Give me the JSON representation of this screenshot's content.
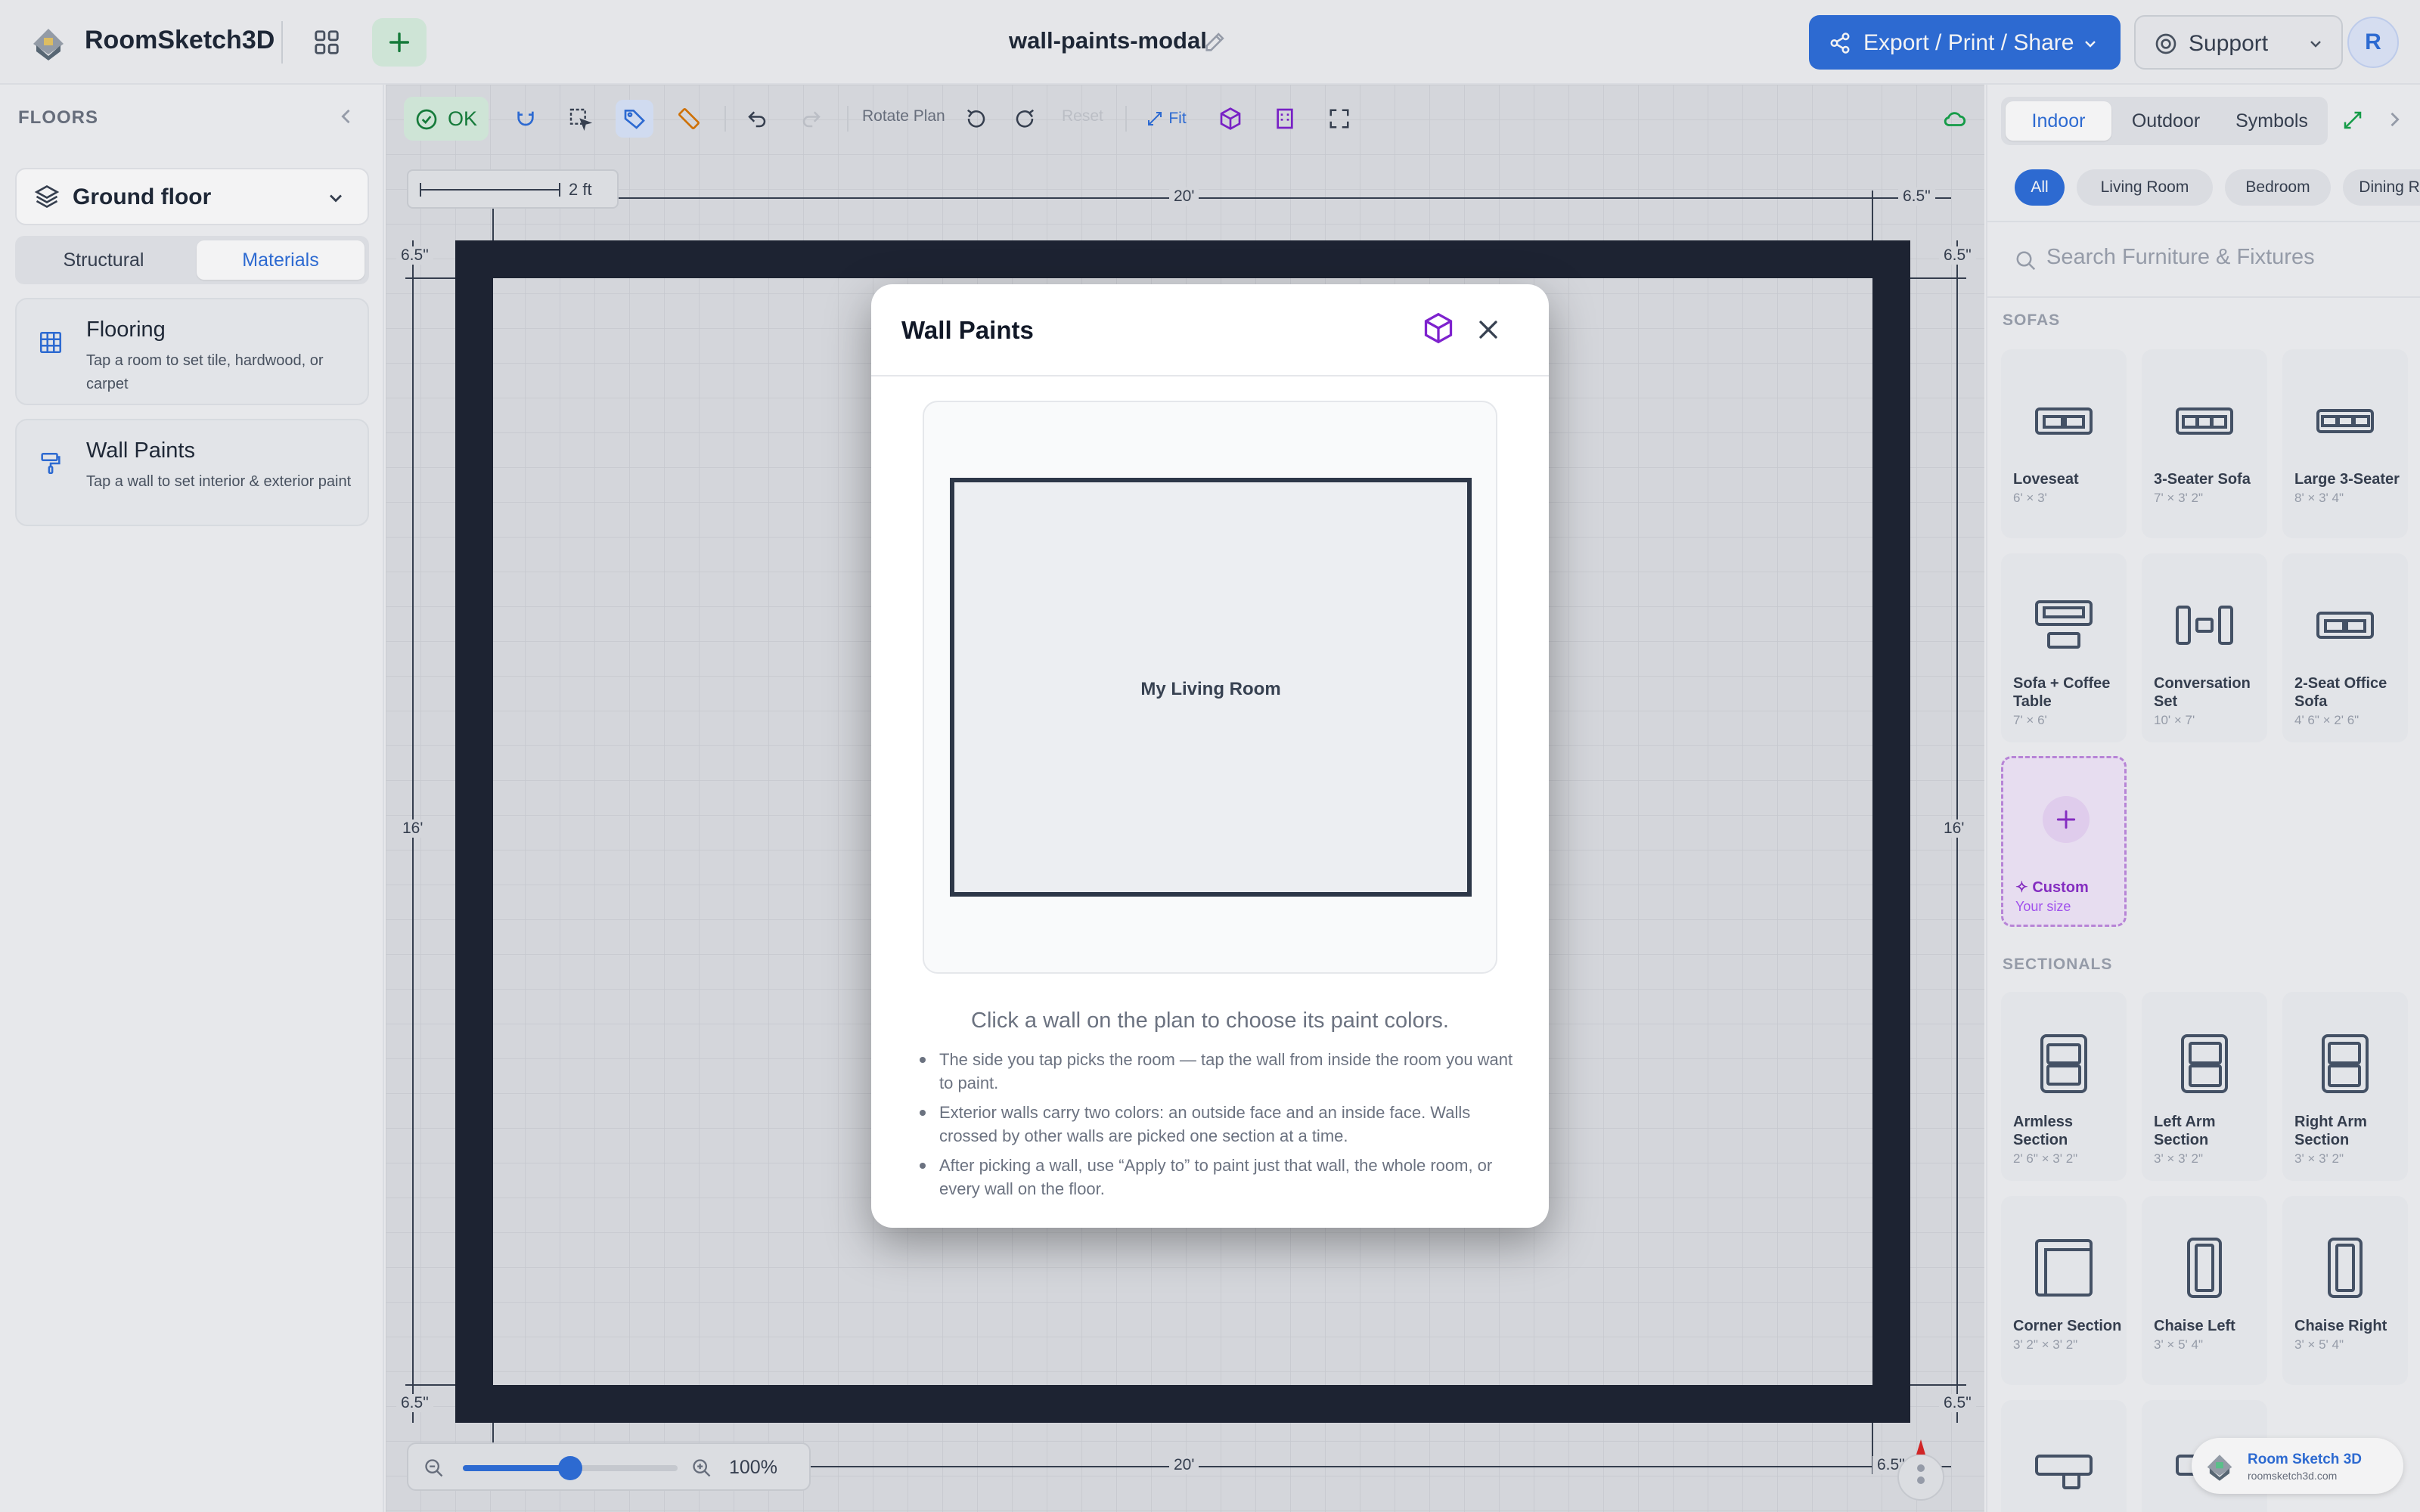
{
  "header": {
    "app_name": "RoomSketch3D",
    "doc_title": "wall-paints-modal",
    "export_label": "Export / Print / Share",
    "support_label": "Support",
    "avatar_initial": "R",
    "accent": "#2f6fdb"
  },
  "left": {
    "floors_label": "FLOORS",
    "floor_selected": "Ground floor",
    "tabs": [
      "Structural",
      "Materials"
    ],
    "active_tab": "Materials",
    "cards": [
      {
        "title": "Flooring",
        "desc": "Tap a room to set tile, hardwood, or carpet",
        "icon": "grid-icon"
      },
      {
        "title": "Wall Paints",
        "desc": "Tap a wall to set interior & exterior paint",
        "icon": "paint-roller-icon"
      }
    ]
  },
  "toolbar": {
    "ok_label": "OK",
    "rotate_label": "Rotate Plan",
    "reset_label": "Reset",
    "fit_label": "Fit",
    "active_tool": "tag-icon"
  },
  "canvas": {
    "scale_label": "2 ft",
    "dim_top": "20'",
    "dim_bottom": "20'",
    "dim_left": "16'",
    "dim_right": "16'",
    "wall_thickness_label": "6.5\"",
    "zoom_label": "100%",
    "zoom_fraction": 0.5,
    "wall_color": "#1e2433"
  },
  "modal": {
    "title": "Wall Paints",
    "room_label": "My Living Room",
    "hint": "Click a wall on the plan to choose its paint colors.",
    "tips": [
      "The side you tap picks the room — tap the wall from inside the room you want to paint.",
      "Exterior walls carry two colors: an outside face and an inside face. Walls crossed by other walls are picked one section at a time.",
      "After picking a wall, use “Apply to” to paint just that wall, the whole room, or every wall on the floor."
    ]
  },
  "right": {
    "tabs": [
      "Indoor",
      "Outdoor",
      "Symbols"
    ],
    "active_tab": "Indoor",
    "chips": [
      "All",
      "Living Room",
      "Bedroom",
      "Dining Room"
    ],
    "active_chip": "All",
    "search_placeholder": "Search Furniture & Fixtures",
    "sections": [
      {
        "label": "SOFAS",
        "items": [
          {
            "name": "Loveseat",
            "size": "6' × 3'"
          },
          {
            "name": "3-Seater Sofa",
            "size": "7' × 3' 2\""
          },
          {
            "name": "Large 3-Seater",
            "size": "8' × 3' 4\""
          },
          {
            "name": "Sofa + Coffee Table",
            "size": "7' × 6'"
          },
          {
            "name": "Conversation Set",
            "size": "10' × 7'"
          },
          {
            "name": "2-Seat Office Sofa",
            "size": "4' 6\" × 2' 6\""
          }
        ]
      },
      {
        "label": "SECTIONALS",
        "items": [
          {
            "name": "Armless Section",
            "size": "2' 6\" × 3' 2\""
          },
          {
            "name": "Left Arm Section",
            "size": "3' × 3' 2\""
          },
          {
            "name": "Right Arm Section",
            "size": "3' × 3' 2\""
          },
          {
            "name": "Corner Section",
            "size": "3' 2\" × 3' 2\""
          },
          {
            "name": "Chaise Left",
            "size": "3' × 5' 4\""
          },
          {
            "name": "Chaise Right",
            "size": "3' × 5' 4\""
          }
        ]
      }
    ],
    "custom": {
      "name": "Custom",
      "sub": "Your size"
    },
    "brand_name": "Room Sketch 3D",
    "brand_url": "roomsketch3d.com"
  }
}
